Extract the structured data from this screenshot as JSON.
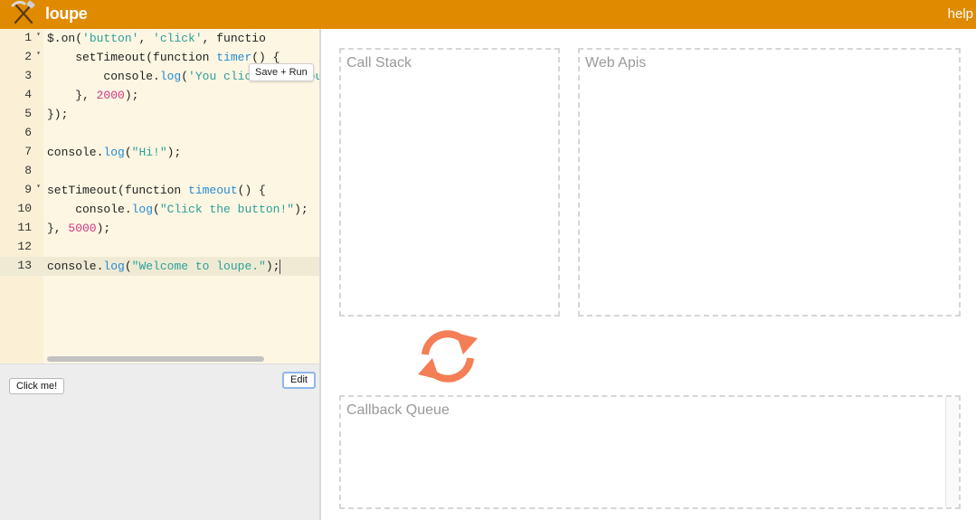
{
  "app": {
    "title": "loupe",
    "help_label": "help"
  },
  "colors": {
    "topbar": "#e08a00",
    "editor_bg": "#fdf6e3",
    "event_loop_icon": "#f47e56"
  },
  "editor": {
    "save_run_label": "Save + Run",
    "lines": [
      {
        "number": "1",
        "fold": true,
        "text": "$.on('button', 'click', functio"
      },
      {
        "number": "2",
        "fold": true,
        "text": "    setTimeout(function timer() {"
      },
      {
        "number": "3",
        "fold": false,
        "text": "        console.log('You clicked the butto"
      },
      {
        "number": "4",
        "fold": false,
        "text": "    }, 2000);"
      },
      {
        "number": "5",
        "fold": false,
        "text": "});"
      },
      {
        "number": "6",
        "fold": false,
        "text": ""
      },
      {
        "number": "7",
        "fold": false,
        "text": "console.log(\"Hi!\");"
      },
      {
        "number": "8",
        "fold": false,
        "text": ""
      },
      {
        "number": "9",
        "fold": true,
        "text": "setTimeout(function timeout() {"
      },
      {
        "number": "10",
        "fold": false,
        "text": "    console.log(\"Click the button!\");"
      },
      {
        "number": "11",
        "fold": false,
        "text": "}, 5000);"
      },
      {
        "number": "12",
        "fold": false,
        "text": ""
      },
      {
        "number": "13",
        "fold": false,
        "text": "console.log(\"Welcome to loupe.\");",
        "active": true
      }
    ]
  },
  "preview": {
    "click_me_label": "Click me!",
    "edit_label": "Edit"
  },
  "panels": {
    "call_stack": "Call Stack",
    "web_apis": "Web Apis",
    "callback_queue": "Callback Queue"
  },
  "icons": {
    "logo": "pickaxe-hammer-icon",
    "event_loop": "refresh-cycle-icon"
  }
}
